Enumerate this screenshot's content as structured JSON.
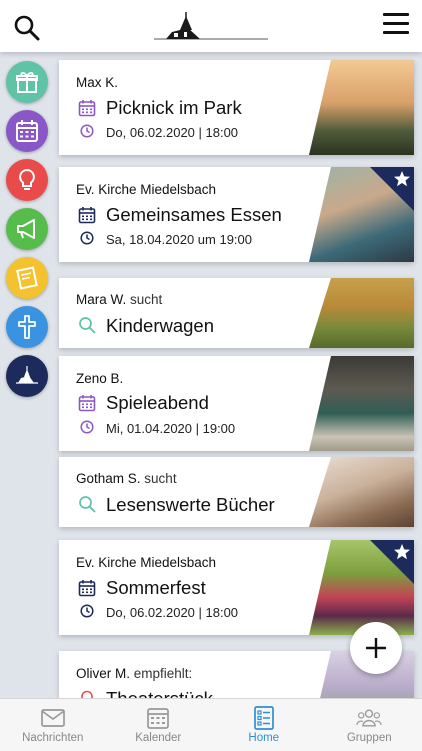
{
  "header": {
    "search_icon": "search-icon",
    "logo_icon": "church-logo-icon",
    "menu_icon": "hamburger-menu-icon"
  },
  "sidebar": [
    {
      "icon": "gift-icon",
      "color": "#5fc3a5"
    },
    {
      "icon": "calendar-icon",
      "color": "#8a57c9"
    },
    {
      "icon": "lightbulb-icon",
      "color": "#e94a4a"
    },
    {
      "icon": "megaphone-icon",
      "color": "#56bd4c"
    },
    {
      "icon": "note-icon",
      "color": "#f3c22e"
    },
    {
      "icon": "cross-icon",
      "color": "#3a93e0"
    },
    {
      "icon": "church-icon",
      "color": "#1d2a5c"
    }
  ],
  "cards": [
    {
      "who": "Max K.",
      "verb": "",
      "title": "Picknick im Park",
      "date": "Do, 06.02.2020 | 18:00",
      "type": "event",
      "icon_color": "#8a57c9",
      "starred": false
    },
    {
      "who": "Ev. Kirche Miedelsbach",
      "verb": "",
      "title": "Gemeinsames Essen",
      "date": "Sa, 18.04.2020 um 19:00",
      "type": "event",
      "icon_color": "#1d2a5c",
      "starred": true
    },
    {
      "who": "Mara W.",
      "verb": "sucht",
      "title": "Kinderwagen",
      "date": "",
      "type": "search",
      "icon_color": "#5fc3a5",
      "starred": false
    },
    {
      "who": "Zeno B.",
      "verb": "",
      "title": "Spieleabend",
      "date": "Mi, 01.04.2020 | 19:00",
      "type": "event",
      "icon_color": "#8a57c9",
      "starred": false
    },
    {
      "who": "Gotham S.",
      "verb": "sucht",
      "title": "Lesenswerte Bücher",
      "date": "",
      "type": "search",
      "icon_color": "#5fc3a5",
      "starred": false
    },
    {
      "who": "Ev. Kirche Miedelsbach",
      "verb": "",
      "title": "Sommerfest",
      "date": "Do, 06.02.2020 | 18:00",
      "type": "event",
      "icon_color": "#1d2a5c",
      "starred": true
    },
    {
      "who": "Oliver M.",
      "verb": "empfiehlt:",
      "title": "Theaterstück",
      "date": "",
      "type": "recommend",
      "icon_color": "#e94a4a",
      "starred": false
    }
  ],
  "fab": {
    "icon": "plus-icon"
  },
  "tabs": [
    {
      "label": "Nachrichten",
      "icon": "mail-icon",
      "active": false
    },
    {
      "label": "Kalender",
      "icon": "calendar-icon",
      "active": false
    },
    {
      "label": "Home",
      "icon": "list-icon",
      "active": true
    },
    {
      "label": "Gruppen",
      "icon": "group-icon",
      "active": false
    }
  ]
}
